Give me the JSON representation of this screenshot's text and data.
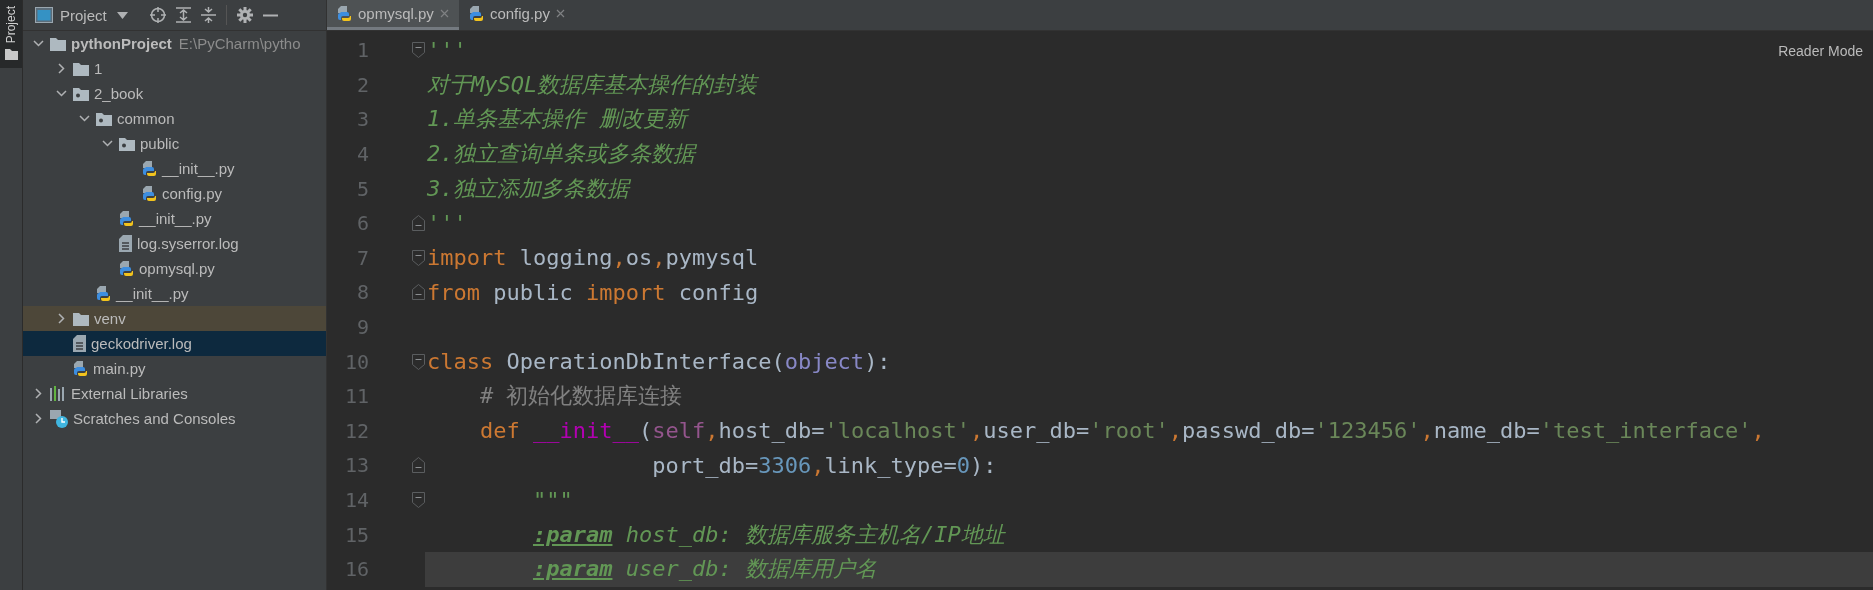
{
  "tool_stripe": {
    "label": "Project",
    "selected": true
  },
  "project_panel": {
    "title": "Project",
    "tree": [
      {
        "label": "pythonProject",
        "kind": "project",
        "path": "E:\\PyCharm\\pytho",
        "expanded": true,
        "selected": false,
        "excluded": false,
        "children": [
          {
            "label": "1",
            "kind": "folder",
            "expanded": false,
            "selected": false,
            "excluded": false
          },
          {
            "label": "2_book",
            "kind": "package",
            "expanded": true,
            "selected": false,
            "excluded": false,
            "children": [
              {
                "label": "common",
                "kind": "package",
                "expanded": true,
                "selected": false,
                "excluded": false,
                "children": [
                  {
                    "label": "public",
                    "kind": "package",
                    "expanded": true,
                    "selected": false,
                    "excluded": false,
                    "children": [
                      {
                        "label": "__init__.py",
                        "kind": "python",
                        "selected": false,
                        "excluded": false
                      },
                      {
                        "label": "config.py",
                        "kind": "python",
                        "selected": false,
                        "excluded": false
                      }
                    ]
                  },
                  {
                    "label": "__init__.py",
                    "kind": "python",
                    "selected": false,
                    "excluded": false
                  },
                  {
                    "label": "log.syserror.log",
                    "kind": "log",
                    "selected": false,
                    "excluded": false
                  },
                  {
                    "label": "opmysql.py",
                    "kind": "python",
                    "selected": false,
                    "excluded": false
                  }
                ]
              },
              {
                "label": "__init__.py",
                "kind": "python",
                "selected": false,
                "excluded": false
              }
            ]
          },
          {
            "label": "venv",
            "kind": "folder",
            "expanded": false,
            "selected": false,
            "excluded": true
          },
          {
            "label": "geckodriver.log",
            "kind": "log",
            "selected": true,
            "excluded": false
          },
          {
            "label": "main.py",
            "kind": "python",
            "selected": false,
            "excluded": false
          }
        ]
      },
      {
        "label": "External Libraries",
        "kind": "libraries",
        "expanded": false,
        "selected": false,
        "excluded": false
      },
      {
        "label": "Scratches and Consoles",
        "kind": "scratches",
        "expanded": false,
        "selected": false,
        "excluded": false
      }
    ]
  },
  "editor_tabs": [
    {
      "label": "opmysql.py",
      "selected": true
    },
    {
      "label": "config.py",
      "selected": false
    }
  ],
  "reader_mode": "Reader Mode",
  "code_lines": [
    {
      "number": "1",
      "fold_start": true,
      "fold_end": false,
      "current": false,
      "tokens": [
        {
          "text": "'''",
          "kind": "doc"
        }
      ]
    },
    {
      "number": "2",
      "fold_start": false,
      "fold_end": false,
      "current": false,
      "tokens": [
        {
          "text": "对于MySQL数据库基本操作的封装",
          "kind": "doc"
        }
      ]
    },
    {
      "number": "3",
      "fold_start": false,
      "fold_end": false,
      "current": false,
      "tokens": [
        {
          "text": "1.单条基本操作 删改更新",
          "kind": "doc"
        }
      ]
    },
    {
      "number": "4",
      "fold_start": false,
      "fold_end": false,
      "current": false,
      "tokens": [
        {
          "text": "2.独立查询单条或多条数据",
          "kind": "doc"
        }
      ]
    },
    {
      "number": "5",
      "fold_start": false,
      "fold_end": false,
      "current": false,
      "tokens": [
        {
          "text": "3.独立添加多条数据",
          "kind": "doc"
        }
      ]
    },
    {
      "number": "6",
      "fold_start": false,
      "fold_end": true,
      "current": false,
      "tokens": [
        {
          "text": "'''",
          "kind": "doc"
        }
      ]
    },
    {
      "number": "7",
      "fold_start": true,
      "fold_end": false,
      "current": false,
      "tokens": [
        {
          "text": "import",
          "kind": "keyword"
        },
        {
          "text": " logging",
          "kind": "plain"
        },
        {
          "text": ",",
          "kind": "keyword"
        },
        {
          "text": "os",
          "kind": "plain"
        },
        {
          "text": ",",
          "kind": "keyword"
        },
        {
          "text": "pymysql",
          "kind": "plain"
        }
      ]
    },
    {
      "number": "8",
      "fold_start": false,
      "fold_end": true,
      "current": false,
      "tokens": [
        {
          "text": "from",
          "kind": "keyword"
        },
        {
          "text": " public ",
          "kind": "plain"
        },
        {
          "text": "import",
          "kind": "keyword"
        },
        {
          "text": " config",
          "kind": "plain"
        }
      ]
    },
    {
      "number": "9",
      "fold_start": false,
      "fold_end": false,
      "current": false
    },
    {
      "number": "10",
      "fold_start": true,
      "fold_end": false,
      "current": false,
      "tokens": [
        {
          "text": "class",
          "kind": "keyword"
        },
        {
          "text": " OperationDbInterface(",
          "kind": "plain"
        },
        {
          "text": "object",
          "kind": "builtin"
        },
        {
          "text": "):",
          "kind": "plain"
        }
      ]
    },
    {
      "number": "11",
      "fold_start": false,
      "fold_end": false,
      "current": false,
      "tokens": [
        {
          "text": "    # 初始化数据库连接",
          "kind": "comment"
        }
      ]
    },
    {
      "number": "12",
      "fold_start": false,
      "fold_end": false,
      "current": false,
      "tokens": [
        {
          "text": "    def ",
          "kind": "keyword"
        },
        {
          "text": "__init__",
          "kind": "magic"
        },
        {
          "text": "(",
          "kind": "plain"
        },
        {
          "text": "self",
          "kind": "self"
        },
        {
          "text": ",",
          "kind": "keyword"
        },
        {
          "text": "host_db=",
          "kind": "plain"
        },
        {
          "text": "'localhost'",
          "kind": "string"
        },
        {
          "text": ",",
          "kind": "keyword"
        },
        {
          "text": "user_db=",
          "kind": "plain"
        },
        {
          "text": "'root'",
          "kind": "string"
        },
        {
          "text": ",",
          "kind": "keyword"
        },
        {
          "text": "passwd_db=",
          "kind": "plain"
        },
        {
          "text": "'123456'",
          "kind": "string"
        },
        {
          "text": ",",
          "kind": "keyword"
        },
        {
          "text": "name_db=",
          "kind": "plain"
        },
        {
          "text": "'test_interface'",
          "kind": "string"
        },
        {
          "text": ",",
          "kind": "keyword"
        }
      ]
    },
    {
      "number": "13",
      "fold_start": false,
      "fold_end": true,
      "current": false,
      "tokens": [
        {
          "text": "                 port_db=",
          "kind": "plain"
        },
        {
          "text": "3306",
          "kind": "number"
        },
        {
          "text": ",",
          "kind": "keyword"
        },
        {
          "text": "link_type=",
          "kind": "plain"
        },
        {
          "text": "0",
          "kind": "number"
        },
        {
          "text": "):",
          "kind": "plain"
        }
      ]
    },
    {
      "number": "14",
      "fold_start": true,
      "fold_end": false,
      "current": false,
      "tokens": [
        {
          "text": "        \"\"\"",
          "kind": "doc"
        }
      ]
    },
    {
      "number": "15",
      "fold_start": false,
      "fold_end": false,
      "current": false,
      "tokens": [
        {
          "text": "        :param",
          "kind": "doctag"
        },
        {
          "text": " host_db: 数据库服务主机名/IP地址",
          "kind": "doc"
        }
      ]
    },
    {
      "number": "16",
      "fold_start": false,
      "fold_end": false,
      "current": true,
      "tokens": [
        {
          "text": "        :param",
          "kind": "doctag"
        },
        {
          "text": " user_db: 数据库用户名",
          "kind": "doc"
        }
      ]
    }
  ]
}
